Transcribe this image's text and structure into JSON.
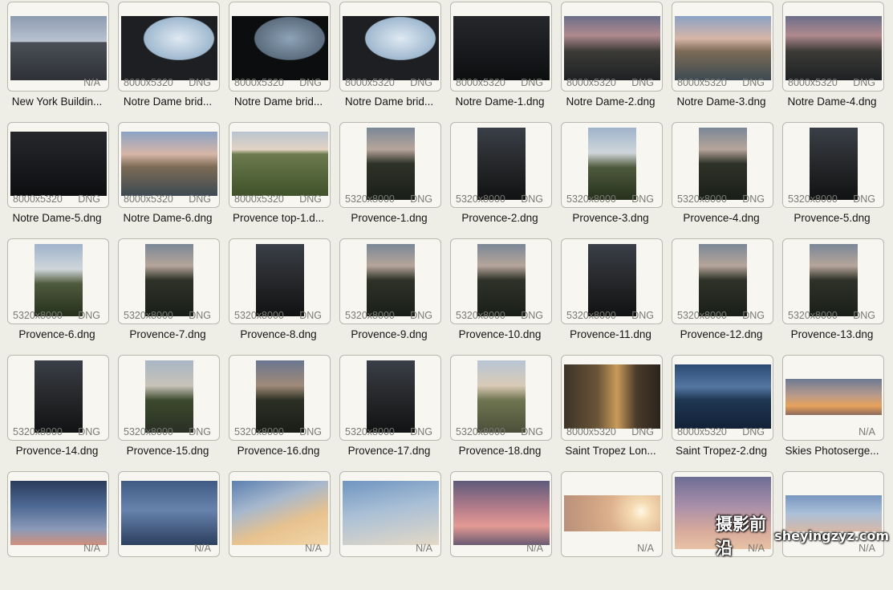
{
  "items": [
    {
      "name": "New York Buildin...",
      "dims": "",
      "fmt": "N/A",
      "thumb": "tall-city"
    },
    {
      "name": "Notre Dame brid...",
      "dims": "8000x5320",
      "fmt": "DNG",
      "thumb": "bridge-bright"
    },
    {
      "name": "Notre Dame brid...",
      "dims": "8000x5320",
      "fmt": "DNG",
      "thumb": "bridge-dark"
    },
    {
      "name": "Notre Dame brid...",
      "dims": "8000x5320",
      "fmt": "DNG",
      "thumb": "bridge-bright"
    },
    {
      "name": "Notre Dame-1.dng",
      "dims": "8000x5320",
      "fmt": "DNG",
      "thumb": "nd-dark"
    },
    {
      "name": "Notre Dame-2.dng",
      "dims": "8000x5320",
      "fmt": "DNG",
      "thumb": "nd-dusk"
    },
    {
      "name": "Notre Dame-3.dng",
      "dims": "8000x5320",
      "fmt": "DNG",
      "thumb": "nd-bright"
    },
    {
      "name": "Notre Dame-4.dng",
      "dims": "8000x5320",
      "fmt": "DNG",
      "thumb": "nd-dusk"
    },
    {
      "name": "Notre Dame-5.dng",
      "dims": "8000x5320",
      "fmt": "DNG",
      "thumb": "nd-dark"
    },
    {
      "name": "Notre Dame-6.dng",
      "dims": "8000x5320",
      "fmt": "DNG",
      "thumb": "nd-bright"
    },
    {
      "name": "Provence top-1.d...",
      "dims": "8000x5320",
      "fmt": "DNG",
      "thumb": "provence-land"
    },
    {
      "name": "Provence-1.dng",
      "dims": "5320x8000",
      "fmt": "DNG",
      "thumb": "p-mid"
    },
    {
      "name": "Provence-2.dng",
      "dims": "5320x8000",
      "fmt": "DNG",
      "thumb": "p-dark"
    },
    {
      "name": "Provence-3.dng",
      "dims": "5320x8000",
      "fmt": "DNG",
      "thumb": "p-bright"
    },
    {
      "name": "Provence-4.dng",
      "dims": "5320x8000",
      "fmt": "DNG",
      "thumb": "p-mid"
    },
    {
      "name": "Provence-5.dng",
      "dims": "5320x8000",
      "fmt": "DNG",
      "thumb": "p-dark"
    },
    {
      "name": "Provence-6.dng",
      "dims": "5320x8000",
      "fmt": "DNG",
      "thumb": "p-bright"
    },
    {
      "name": "Provence-7.dng",
      "dims": "5320x8000",
      "fmt": "DNG",
      "thumb": "p-mid"
    },
    {
      "name": "Provence-8.dng",
      "dims": "5320x8000",
      "fmt": "DNG",
      "thumb": "p-dark"
    },
    {
      "name": "Provence-9.dng",
      "dims": "5320x8000",
      "fmt": "DNG",
      "thumb": "p-mid"
    },
    {
      "name": "Provence-10.dng",
      "dims": "5320x8000",
      "fmt": "DNG",
      "thumb": "p-mid"
    },
    {
      "name": "Provence-11.dng",
      "dims": "5320x8000",
      "fmt": "DNG",
      "thumb": "p-dark"
    },
    {
      "name": "Provence-12.dng",
      "dims": "5320x8000",
      "fmt": "DNG",
      "thumb": "p-mid"
    },
    {
      "name": "Provence-13.dng",
      "dims": "5320x8000",
      "fmt": "DNG",
      "thumb": "p-mid"
    },
    {
      "name": "Provence-14.dng",
      "dims": "5320x8000",
      "fmt": "DNG",
      "thumb": "p-dark"
    },
    {
      "name": "Provence-15.dng",
      "dims": "5320x8000",
      "fmt": "DNG",
      "thumb": "p-garden"
    },
    {
      "name": "Provence-16.dng",
      "dims": "5320x8000",
      "fmt": "DNG",
      "thumb": "p-garden-dusk"
    },
    {
      "name": "Provence-17.dng",
      "dims": "5320x8000",
      "fmt": "DNG",
      "thumb": "p-dark"
    },
    {
      "name": "Provence-18.dng",
      "dims": "5320x8000",
      "fmt": "DNG",
      "thumb": "p-garden-bright"
    },
    {
      "name": "Saint Tropez Lon...",
      "dims": "8000x5320",
      "fmt": "DNG",
      "thumb": "st-street"
    },
    {
      "name": "Saint Tropez-2.dng",
      "dims": "8000x5320",
      "fmt": "DNG",
      "thumb": "st-harbor"
    },
    {
      "name": "Skies Photoserge...",
      "dims": "",
      "fmt": "N/A",
      "thumb": "sky-sunset-wide"
    },
    {
      "name": "",
      "dims": "",
      "fmt": "N/A",
      "thumb": "sky-blue-dusk"
    },
    {
      "name": "",
      "dims": "",
      "fmt": "N/A",
      "thumb": "sky-blue-clouds"
    },
    {
      "name": "",
      "dims": "",
      "fmt": "N/A",
      "thumb": "sky-golden"
    },
    {
      "name": "",
      "dims": "",
      "fmt": "N/A",
      "thumb": "sky-light-blue"
    },
    {
      "name": "",
      "dims": "",
      "fmt": "N/A",
      "thumb": "sky-pink"
    },
    {
      "name": "",
      "dims": "",
      "fmt": "N/A",
      "thumb": "sky-sun-wide"
    },
    {
      "name": "",
      "dims": "",
      "fmt": "N/A",
      "thumb": "sky-purple"
    },
    {
      "name": "",
      "dims": "",
      "fmt": "N/A",
      "thumb": "sky-wide-blue"
    }
  ],
  "watermark": {
    "cn": "摄影前沿",
    "en": "sheyingzyz.com"
  }
}
